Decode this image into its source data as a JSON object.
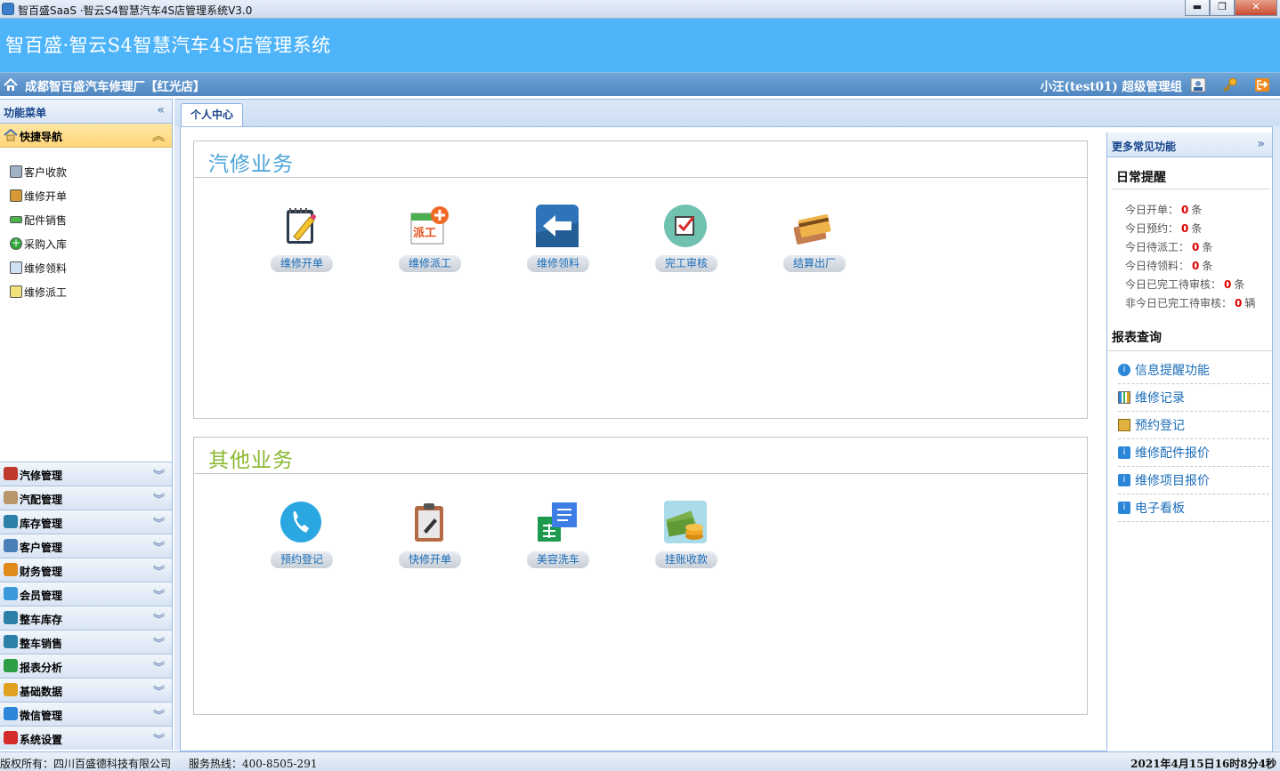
{
  "window": {
    "title": "智百盛SaaS ·智云S4智慧汽车4S店管理系统V3.0",
    "minimize": "▬",
    "maximize": "❐",
    "close": "✕"
  },
  "banner": {
    "title": "智百盛·智云S4智慧汽车4S店管理系统"
  },
  "infobar": {
    "shop_name": "成都智百盛汽车修理厂【红光店】",
    "user": "小汪(test01)  超级管理组"
  },
  "sidebar": {
    "header": "功能菜单",
    "quick_nav": "快捷导航",
    "quick_items": [
      {
        "label": "客户收款",
        "icon": "cashier-icon"
      },
      {
        "label": "维修开单",
        "icon": "book-icon"
      },
      {
        "label": "配件销售",
        "icon": "parts-icon"
      },
      {
        "label": "采购入库",
        "icon": "plus-icon"
      },
      {
        "label": "维修领料",
        "icon": "pick-icon"
      },
      {
        "label": "维修派工",
        "icon": "dispatch-icon"
      }
    ],
    "sections": [
      {
        "label": "汽修管理",
        "icon": "tools-icon"
      },
      {
        "label": "汽配管理",
        "icon": "box-icon"
      },
      {
        "label": "库存管理",
        "icon": "warehouse-icon"
      },
      {
        "label": "客户管理",
        "icon": "customer-icon"
      },
      {
        "label": "财务管理",
        "icon": "finance-icon"
      },
      {
        "label": "会员管理",
        "icon": "member-icon"
      },
      {
        "label": "整车库存",
        "icon": "car-stock-icon"
      },
      {
        "label": "整车销售",
        "icon": "car-sales-icon"
      },
      {
        "label": "报表分析",
        "icon": "pie-chart-icon"
      },
      {
        "label": "基础数据",
        "icon": "database-icon"
      },
      {
        "label": "微信管理",
        "icon": "wechat-icon"
      },
      {
        "label": "系统设置",
        "icon": "settings-icon"
      }
    ]
  },
  "tab": {
    "label": "个人中心"
  },
  "panels": {
    "repair": {
      "title": "汽修业务",
      "title_color": "#4aa3d8",
      "items": [
        "维修开单",
        "维修派工",
        "维修领料",
        "完工审核",
        "结算出厂"
      ]
    },
    "other": {
      "title": "其他业务",
      "title_color": "#8bb832",
      "items": [
        "预约登记",
        "快修开单",
        "美容洗车",
        "挂账收款"
      ]
    }
  },
  "right": {
    "header": "更多常见功能",
    "daily_title": "日常提醒",
    "reminders": [
      {
        "label": "今日开单：",
        "count": "0",
        "unit": "条"
      },
      {
        "label": "今日预约：",
        "count": "0",
        "unit": "条"
      },
      {
        "label": "今日待派工：",
        "count": "0",
        "unit": "条"
      },
      {
        "label": "今日待领料：",
        "count": "0",
        "unit": "条"
      },
      {
        "label": "今日已完工待审核：",
        "count": "0",
        "unit": "条"
      },
      {
        "label": "非今日已完工待审核：",
        "count": "0",
        "unit": "辆"
      }
    ],
    "report_title": "报表查询",
    "links": [
      {
        "label": "信息提醒功能",
        "icon": "info-icon"
      },
      {
        "label": "维修记录",
        "icon": "report-chart-icon"
      },
      {
        "label": "预约登记",
        "icon": "monitor-icon"
      },
      {
        "label": "维修配件报价",
        "icon": "info-icon"
      },
      {
        "label": "维修项目报价",
        "icon": "info-icon"
      },
      {
        "label": "电子看板",
        "icon": "info-icon"
      }
    ]
  },
  "status": {
    "copyright": "版权所有：四川百盛德科技有限公司",
    "hotline": "服务热线：400-8505-291",
    "datetime": "2021年4月15日16时8分4秒"
  }
}
